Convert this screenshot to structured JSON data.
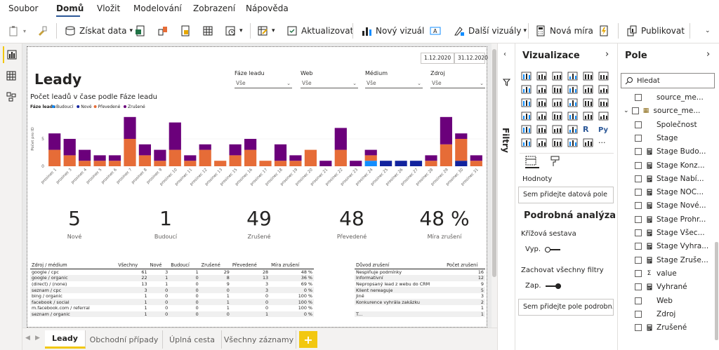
{
  "menu": {
    "items": [
      "Soubor",
      "Domů",
      "Vložit",
      "Modelování",
      "Zobrazení",
      "Nápověda"
    ],
    "active": "Domů"
  },
  "ribbon": {
    "get_data": "Získat data",
    "refresh": "Aktualizovat",
    "new_visual": "Nový vizuál",
    "more_visuals": "Další vizuály",
    "new_measure": "Nová míra",
    "publish": "Publikovat"
  },
  "report": {
    "title": "Leady",
    "chart_title": "Počet leadů v čase podle Fáze leadu",
    "date_from": "1.12.2020",
    "date_to": "31.12.2020",
    "slicers": [
      {
        "label": "Fáze leadu",
        "value": "Vše"
      },
      {
        "label": "Web",
        "value": "Vše"
      },
      {
        "label": "Médium",
        "value": "Vše"
      },
      {
        "label": "Zdroj",
        "value": "Vše"
      }
    ],
    "kpis": [
      {
        "value": "5",
        "label": "Nové"
      },
      {
        "value": "1",
        "label": "Budoucí"
      },
      {
        "value": "49",
        "label": "Zrušené"
      },
      {
        "value": "48",
        "label": "Převedené"
      },
      {
        "value": "48 %",
        "label": "Míra zrušení"
      }
    ],
    "source_table": {
      "headers": [
        "Zdroj / médium",
        "Všechny",
        "Nové",
        "Budoucí",
        "Zrušené",
        "Převedené",
        "Míra zrušení"
      ],
      "rows": [
        [
          "google / cpc",
          "61",
          "3",
          "1",
          "29",
          "28",
          "48 %"
        ],
        [
          "google / organic",
          "22",
          "1",
          "0",
          "8",
          "13",
          "36 %"
        ],
        [
          "(direct) / (none)",
          "13",
          "1",
          "0",
          "9",
          "3",
          "69 %"
        ],
        [
          "seznam / cpc",
          "3",
          "0",
          "0",
          "0",
          "3",
          "0 %"
        ],
        [
          "bing / organic",
          "1",
          "0",
          "0",
          "1",
          "0",
          "100 %"
        ],
        [
          "facebook / social",
          "1",
          "0",
          "0",
          "1",
          "0",
          "100 %"
        ],
        [
          "m.facebook.com / referral",
          "1",
          "0",
          "0",
          "1",
          "0",
          "100 %"
        ],
        [
          "seznam / organic",
          "1",
          "0",
          "0",
          "0",
          "1",
          "0 %"
        ]
      ]
    },
    "reason_table": {
      "headers": [
        "Důvod zrušení",
        "Počet zrušení"
      ],
      "rows": [
        [
          "Nesplňuje podmínky",
          "16"
        ],
        [
          "Informativní",
          "12"
        ],
        [
          "Nepropsaný lead z webu do CRM",
          "9"
        ],
        [
          "Klient nereaguje",
          "5"
        ],
        [
          "Jiné",
          "3"
        ],
        [
          "Konkurence vyhrála zakázku",
          "2"
        ],
        [
          "",
          "1"
        ],
        [
          "T...",
          "1"
        ]
      ]
    }
  },
  "chart_data": {
    "type": "bar",
    "stacked": true,
    "title": "Počet leadů v čase podle Fáze leadu",
    "legend_title": "Fáze leadu",
    "ylabel": "Počet pro ID",
    "ylim": [
      0,
      10
    ],
    "yticks": [
      0,
      5
    ],
    "categories": [
      "prosinec 1",
      "prosinec 3",
      "prosinec 4",
      "prosinec 5",
      "prosinec 6",
      "prosinec 7",
      "prosinec 8",
      "prosinec 9",
      "prosinec 10",
      "prosinec 11",
      "prosinec 12",
      "prosinec 13",
      "prosinec 15",
      "prosinec 16",
      "prosinec 17",
      "prosinec 18",
      "prosinec 19",
      "prosinec 20",
      "prosinec 21",
      "prosinec 22",
      "prosinec 23",
      "prosinec 24",
      "prosinec 25",
      "prosinec 26",
      "prosinec 27",
      "prosinec 28",
      "prosinec 29",
      "prosinec 30",
      "prosinec 31"
    ],
    "series": [
      {
        "name": "Budoucí",
        "color": "#118DFF",
        "values": [
          0,
          0,
          0,
          0,
          0,
          0,
          0,
          0,
          0,
          0,
          0,
          0,
          0,
          0,
          0,
          0,
          0,
          0,
          0,
          0,
          0,
          1,
          0,
          0,
          0,
          0,
          0,
          0,
          0
        ]
      },
      {
        "name": "Nové",
        "color": "#12239E",
        "values": [
          0,
          0,
          0,
          0,
          0,
          0,
          0,
          0,
          0,
          0,
          0,
          0,
          0,
          0,
          0,
          0,
          0,
          0,
          0,
          0,
          0,
          0,
          1,
          1,
          1,
          0,
          0,
          1,
          0
        ]
      },
      {
        "name": "Převedené",
        "color": "#E66C37",
        "values": [
          3,
          2,
          1,
          1,
          1,
          5,
          2,
          1,
          3,
          1,
          3,
          1,
          2,
          3,
          1,
          1,
          1,
          3,
          0,
          3,
          0,
          1,
          0,
          0,
          0,
          1,
          4,
          4,
          1
        ]
      },
      {
        "name": "Zrušené",
        "color": "#6B007B",
        "values": [
          3,
          3,
          2,
          1,
          1,
          4,
          2,
          2,
          5,
          1,
          1,
          0,
          2,
          2,
          0,
          3,
          1,
          0,
          1,
          4,
          1,
          1,
          0,
          0,
          0,
          1,
          5,
          1,
          1
        ]
      }
    ]
  },
  "viz_pane": {
    "title": "Vizualizace",
    "values_label": "Hodnoty",
    "values_placeholder": "Sem přidejte datová pole",
    "drill_title": "Podrobná analýza",
    "cross_report": "Křížová sestava",
    "cross_state": "Vyp.",
    "keep_filters": "Zachovat všechny filtry",
    "keep_state": "Zap.",
    "drill_placeholder": "Sem přidejte pole podrobn..."
  },
  "filters_label": "Filtry",
  "fields_pane": {
    "title": "Pole",
    "search_placeholder": "Hledat",
    "fields": [
      {
        "name": "source_me...",
        "kind": "field"
      },
      {
        "name": "source_me...",
        "kind": "table"
      },
      {
        "name": "Společnost",
        "kind": "field"
      },
      {
        "name": "Stage",
        "kind": "field"
      },
      {
        "name": "Stage Budo...",
        "kind": "measure"
      },
      {
        "name": "Stage Konz...",
        "kind": "measure"
      },
      {
        "name": "Stage Nabí...",
        "kind": "measure"
      },
      {
        "name": "Stage NOC...",
        "kind": "measure"
      },
      {
        "name": "Stage Nové...",
        "kind": "measure"
      },
      {
        "name": "Stage Prohr...",
        "kind": "measure"
      },
      {
        "name": "Stage Všec...",
        "kind": "measure"
      },
      {
        "name": "Stage Vyhra...",
        "kind": "measure"
      },
      {
        "name": "Stage Zruše...",
        "kind": "measure"
      },
      {
        "name": "value",
        "kind": "sum"
      },
      {
        "name": "Vyhrané",
        "kind": "measure"
      },
      {
        "name": "Web",
        "kind": "field"
      },
      {
        "name": "Zdroj",
        "kind": "field"
      },
      {
        "name": "Zrušené",
        "kind": "measure"
      }
    ]
  },
  "tabs": [
    "Leady",
    "Obchodní případy",
    "Úplná cesta",
    "Všechny záznamy"
  ],
  "active_tab": "Leady",
  "colors": {
    "accent": "#F2C811",
    "budouci": "#118DFF",
    "nove": "#12239E",
    "prevedene": "#E66C37",
    "zrusene": "#6B007B"
  }
}
